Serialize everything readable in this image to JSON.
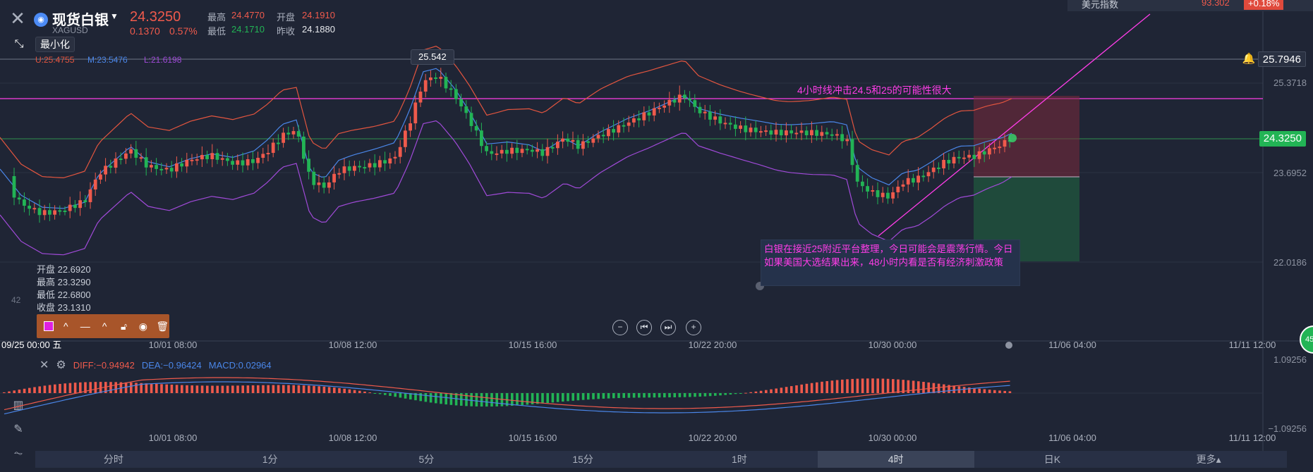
{
  "header": {
    "symbol_name": "现货白银",
    "symbol_code": "XAGUSD",
    "price": "24.3250",
    "change": "0.1370",
    "change_pct": "0.57%",
    "high_label": "最高",
    "high_value": "24.4770",
    "open_label": "开盘",
    "open_value": "24.1910",
    "low_label": "最低",
    "low_value": "24.1710",
    "prev_close_label": "昨收",
    "prev_close_value": "24.1880",
    "minimize_tooltip": "最小化"
  },
  "usd_index": {
    "name": "美元指数",
    "value": "93.302",
    "change_pct": "+0.18%"
  },
  "bollinger": {
    "upper": "U:25.4755",
    "middle": "M:23.5476",
    "lower": "L:21.6198"
  },
  "hover_ohlc": {
    "open": "开盘 22.6920",
    "high": "最高 23.3290",
    "low": "最低 22.6800",
    "close": "收盘 23.1310"
  },
  "annotations": {
    "top_note": "4小时线冲击24.5和25的可能性很大",
    "box_note": "白银在接近25附近平台整理，今日可能会是震荡行情。今日如果美国大选结果出来，48小时内看是否有经济刺激政策"
  },
  "price_labels": {
    "high_pill": "25.542",
    "alert_line": "25.7946",
    "current": "24.3250",
    "tick_1": "25.3718",
    "tick_2": "23.6952",
    "tick_3": "22.0186",
    "left_cut": "42"
  },
  "x_axis": {
    "start_label": "09/25 00:00 五",
    "labels": [
      "10/01 08:00",
      "10/08 12:00",
      "10/15 16:00",
      "10/22 20:00",
      "10/30 00:00",
      "11/06 04:00",
      "11/11 12:00"
    ]
  },
  "macd": {
    "diff": "DIFF:−0.94942",
    "dea": "DEA:−0.96424",
    "macd": "MACD:0.02964",
    "top_tick": "1.09256",
    "bottom_tick": "−1.09256"
  },
  "side_badge": "45",
  "timeframes": [
    "分时",
    "1分",
    "5分",
    "15分",
    "1时",
    "4时",
    "日K",
    "更多▴"
  ],
  "active_timeframe": "4时",
  "colors": {
    "up": "#ef5a4c",
    "down": "#22b455",
    "annotation": "#ff3de8",
    "upper_band": "#e2553f",
    "middle_band": "#4a86e8",
    "lower_band": "#a04ad8",
    "background": "#1f2535"
  }
}
